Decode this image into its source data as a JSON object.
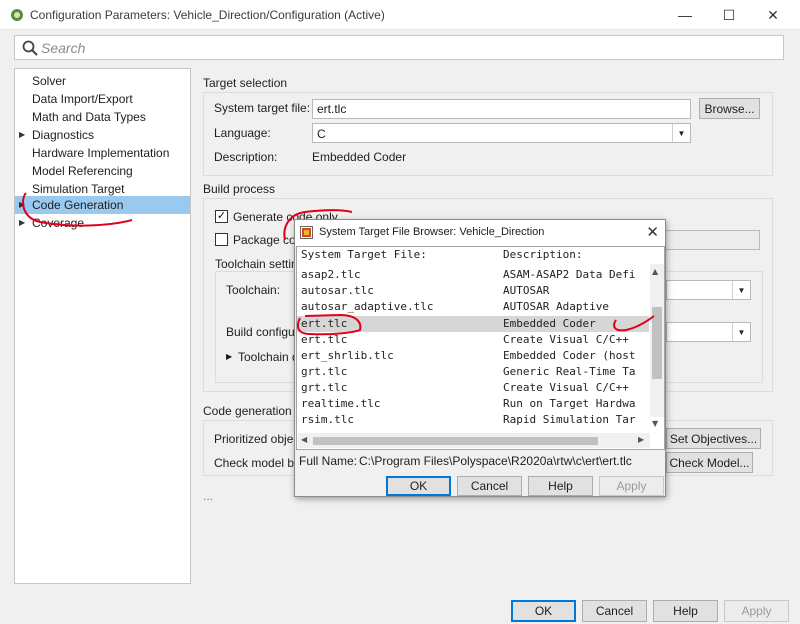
{
  "window": {
    "title": "Configuration Parameters: Vehicle_Direction/Configuration (Active)",
    "controls": [
      "—",
      "☐",
      "✕"
    ]
  },
  "search": {
    "placeholder": "Search"
  },
  "tree": {
    "items": [
      {
        "label": "Solver",
        "arrow": false,
        "selected": false
      },
      {
        "label": "Data Import/Export",
        "arrow": false,
        "selected": false
      },
      {
        "label": "Math and Data Types",
        "arrow": false,
        "selected": false
      },
      {
        "label": "Diagnostics",
        "arrow": true,
        "selected": false
      },
      {
        "label": "Hardware Implementation",
        "arrow": false,
        "selected": false
      },
      {
        "label": "Model Referencing",
        "arrow": false,
        "selected": false
      },
      {
        "label": "Simulation Target",
        "arrow": false,
        "selected": false
      },
      {
        "label": "Code Generation",
        "arrow": true,
        "selected": true
      },
      {
        "label": "Coverage",
        "arrow": true,
        "selected": false
      }
    ]
  },
  "target_selection": {
    "heading": "Target selection",
    "system_target_label": "System target file:",
    "system_target_value": "ert.tlc",
    "browse_label": "Browse...",
    "language_label": "Language:",
    "language_value": "C",
    "description_label": "Description:",
    "description_value": "Embedded Coder"
  },
  "build_process": {
    "heading": "Build process",
    "generate_code_only": "Generate code only",
    "generate_code_only_checked": true,
    "package_code": "Package co",
    "package_code_checked": false,
    "toolchain_settings": "Toolchain setting",
    "toolchain_label": "Toolchain:",
    "build_config_label": "Build configur",
    "toolchain_details": "Toolchain d"
  },
  "code_gen_objectives": {
    "heading": "Code generation o",
    "prioritized_label": "Prioritized objec",
    "set_objectives": "Set Objectives...",
    "check_model_label": "Check model be",
    "check_model": "Check Model..."
  },
  "ellipsis": "...",
  "footer": {
    "ok": "OK",
    "cancel": "Cancel",
    "help": "Help",
    "apply": "Apply"
  },
  "browser_dialog": {
    "title": "System Target File Browser: Vehicle_Direction",
    "col_file": "System Target File:",
    "col_desc": "Description:",
    "rows": [
      {
        "file": "asap2.tlc",
        "desc": "ASAM-ASAP2 Data Defi"
      },
      {
        "file": "autosar.tlc",
        "desc": "AUTOSAR"
      },
      {
        "file": "autosar_adaptive.tlc",
        "desc": "AUTOSAR Adaptive"
      },
      {
        "file": "ert.tlc",
        "desc": "Embedded Coder",
        "selected": true
      },
      {
        "file": "ert.tlc",
        "desc": "Create Visual C/C++"
      },
      {
        "file": "ert_shrlib.tlc",
        "desc": "Embedded Coder (host"
      },
      {
        "file": "grt.tlc",
        "desc": "Generic Real-Time Ta"
      },
      {
        "file": "grt.tlc",
        "desc": "Create Visual C/C++"
      },
      {
        "file": "realtime.tlc",
        "desc": "Run on Target Hardwa"
      },
      {
        "file": "rsim.tlc",
        "desc": "Rapid Simulation Tar"
      }
    ],
    "full_name_label": "Full Name:",
    "full_name_value": "C:\\Program Files\\Polyspace\\R2020a\\rtw\\c\\ert\\ert.tlc",
    "ok": "OK",
    "cancel": "Cancel",
    "help": "Help",
    "apply": "Apply"
  },
  "colors": {
    "selection": "#99c9ef",
    "annotation": "#e0001b"
  }
}
